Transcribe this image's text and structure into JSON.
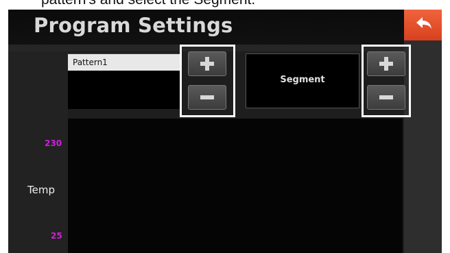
{
  "caption": "pattern's and select the Segment.",
  "header": {
    "title": "Program Settings",
    "back_icon": "back-arrow-icon",
    "back_color": "#e8502a"
  },
  "pattern": {
    "selected": "Pattern1",
    "add_icon": "plus-icon",
    "remove_icon": "minus-icon"
  },
  "segment": {
    "label": "Segment",
    "add_icon": "plus-icon",
    "remove_icon": "minus-icon"
  },
  "chart": {
    "ylabel": "Temp",
    "y_top": "230",
    "y_bottom": "25",
    "tick_color": "#d01ee0"
  }
}
